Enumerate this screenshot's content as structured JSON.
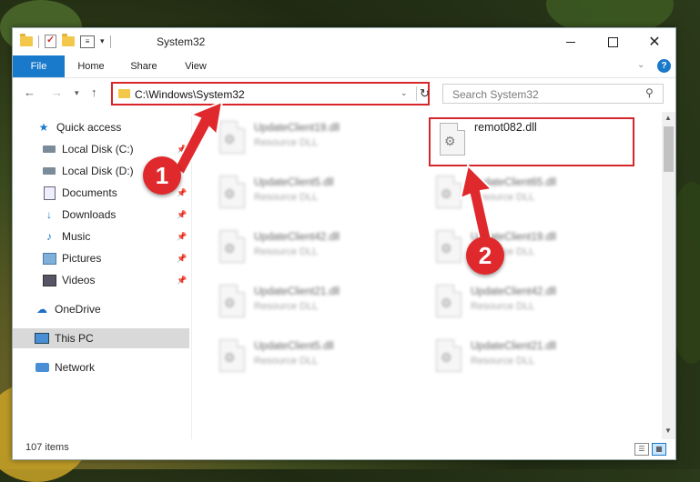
{
  "window": {
    "title": "System32",
    "minimize": "—",
    "close": "✕"
  },
  "ribbon": {
    "tabs": [
      "File",
      "Home",
      "Share",
      "View"
    ],
    "help": "?"
  },
  "address": {
    "path": "C:\\Windows\\System32",
    "refresh_glyph": "↻"
  },
  "search": {
    "placeholder": "Search System32"
  },
  "sidebar": {
    "items": [
      {
        "label": "Quick access",
        "icon": "star-icon",
        "pinned": false
      },
      {
        "label": "Local Disk (C:)",
        "icon": "disk-icon",
        "pinned": true
      },
      {
        "label": "Local Disk (D:)",
        "icon": "disk-icon",
        "pinned": true
      },
      {
        "label": "Documents",
        "icon": "documents-icon",
        "pinned": true
      },
      {
        "label": "Downloads",
        "icon": "downloads-icon",
        "pinned": true
      },
      {
        "label": "Music",
        "icon": "music-icon",
        "pinned": true
      },
      {
        "label": "Pictures",
        "icon": "pictures-icon",
        "pinned": true
      },
      {
        "label": "Videos",
        "icon": "videos-icon",
        "pinned": true
      },
      {
        "label": "OneDrive",
        "icon": "cloud-icon",
        "pinned": false
      },
      {
        "label": "This PC",
        "icon": "computer-icon",
        "pinned": false,
        "selected": true
      },
      {
        "label": "Network",
        "icon": "network-icon",
        "pinned": false
      }
    ]
  },
  "files": {
    "left": [
      {
        "name": "UpdateClient19.dll",
        "type": "Resource DLL"
      },
      {
        "name": "UpdateClient5.dll",
        "type": "Resource DLL"
      },
      {
        "name": "UpdateClient42.dll",
        "type": "Resource DLL"
      },
      {
        "name": "UpdateClient21.dll",
        "type": "Resource DLL"
      },
      {
        "name": "UpdateClient5.dll",
        "type": "Resource DLL"
      }
    ],
    "right": [
      {
        "name": "remot082.dll",
        "type": "",
        "highlighted": true
      },
      {
        "name": "UpdateClient65.dll",
        "type": "Resource DLL"
      },
      {
        "name": "UpdateClient19.dll",
        "type": "Resource DLL"
      },
      {
        "name": "UpdateClient42.dll",
        "type": "Resource DLL"
      },
      {
        "name": "UpdateClient21.dll",
        "type": "Resource DLL"
      }
    ]
  },
  "status": {
    "item_count": "107 items"
  },
  "annotations": {
    "step1": "1",
    "step2": "2",
    "color": "#e0292c"
  },
  "colors": {
    "accent": "#1979ca",
    "highlight_border": "#d6262a"
  }
}
